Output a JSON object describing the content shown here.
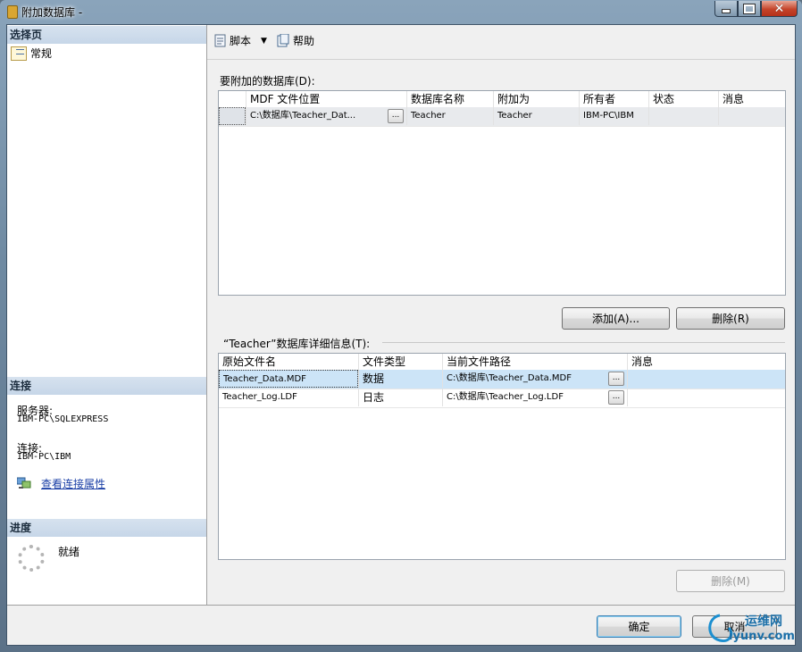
{
  "window": {
    "title": "附加数据库 -"
  },
  "left": {
    "select_page_header": "选择页",
    "pages": [
      "常规"
    ],
    "connection_header": "连接",
    "server_label": "服务器:",
    "server_value": "IBM-PC\\SQLEXPRESS",
    "connection_label": "连接:",
    "connection_value": "IBM-PC\\IBM",
    "view_properties_link": "查看连接属性",
    "progress_header": "进度",
    "progress_status": "就绪"
  },
  "toolbar": {
    "script_label": "脚本",
    "help_label": "帮助"
  },
  "attach": {
    "label": "要附加的数据库(D):",
    "columns": [
      "MDF 文件位置",
      "数据库名称",
      "附加为",
      "所有者",
      "状态",
      "消息"
    ],
    "rows": [
      {
        "mdf": "C:\\数据库\\Teacher_Dat...",
        "db_name": "Teacher",
        "attach_as": "Teacher",
        "owner": "IBM-PC\\IBM",
        "status": "",
        "message": ""
      }
    ],
    "add_button": "添加(A)...",
    "remove_button": "删除(R)"
  },
  "details": {
    "label": "“Teacher”数据库详细信息(T):",
    "columns": [
      "原始文件名",
      "文件类型",
      "当前文件路径",
      "消息"
    ],
    "rows": [
      {
        "file": "Teacher_Data.MDF",
        "type": "数据",
        "path": "C:\\数据库\\Teacher_Data.MDF",
        "message": ""
      },
      {
        "file": "Teacher_Log.LDF",
        "type": "日志",
        "path": "C:\\数据库\\Teacher_Log.LDF",
        "message": ""
      }
    ],
    "remove_button": "删除(M)"
  },
  "footer": {
    "ok_button": "确定",
    "cancel_button": "取消"
  },
  "watermark": {
    "text1": "运维网",
    "text2": "iyunv.com"
  },
  "ellipsis": "..."
}
